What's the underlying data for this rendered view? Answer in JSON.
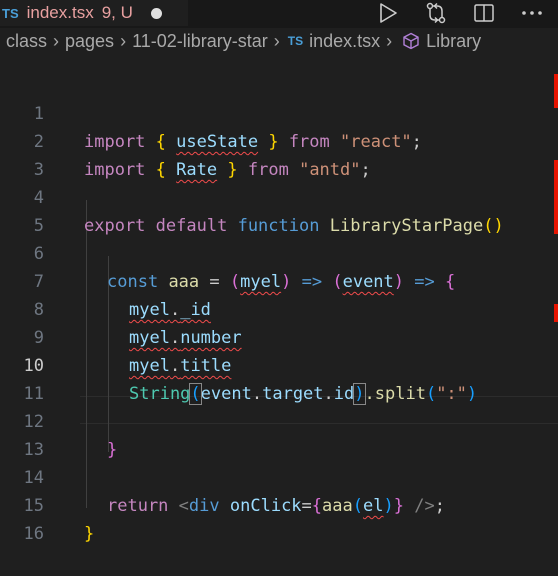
{
  "tab": {
    "lang_badge": "TS",
    "filename": "index.tsx",
    "status": "9, U"
  },
  "actions": [
    "run-icon",
    "source-control-icon",
    "split-editor-icon",
    "more-icon"
  ],
  "breadcrumbs": {
    "items": [
      "class",
      "pages",
      "11-02-library-star"
    ],
    "file_badge": "TS",
    "file": "index.tsx",
    "symbol": "Library"
  },
  "code": {
    "active_line": 10,
    "lines": [
      {
        "n": "1"
      },
      {
        "n": "2"
      },
      {
        "n": "3"
      },
      {
        "n": "4"
      },
      {
        "n": "5"
      },
      {
        "n": "6"
      },
      {
        "n": "7"
      },
      {
        "n": "8"
      },
      {
        "n": "9"
      },
      {
        "n": "10"
      },
      {
        "n": "11"
      },
      {
        "n": "12"
      },
      {
        "n": "13"
      },
      {
        "n": "14"
      },
      {
        "n": "15"
      },
      {
        "n": "16"
      }
    ],
    "tokens": {
      "l1": [
        "import",
        "{",
        "useState",
        "}",
        "from",
        "\"react\"",
        ";"
      ],
      "l2": [
        "import",
        "{",
        "Rate",
        "}",
        "from",
        "\"antd\"",
        ";"
      ],
      "l4": [
        "export",
        "default",
        "function",
        "LibraryStarPage",
        "()"
      ],
      "l6": [
        "const",
        "aaa",
        "=",
        "(",
        "myel",
        ")",
        "=>",
        "(",
        "event",
        ")",
        "=>",
        "{"
      ],
      "l7": [
        "myel",
        ".",
        "_id"
      ],
      "l8": [
        "myel",
        ".",
        "number"
      ],
      "l9": [
        "myel",
        ".",
        "title"
      ],
      "l10": [
        "String",
        "(",
        "event",
        ".",
        "target",
        ".",
        "id",
        ")",
        ".split",
        "(",
        "\":\"",
        ")"
      ],
      "l12": [
        "}"
      ],
      "l14": [
        "return",
        "<",
        "div",
        "onClick",
        "=",
        "{",
        "aaa",
        "(",
        "el",
        ")",
        "}",
        "/>",
        ";"
      ],
      "l15": [
        "}"
      ]
    }
  },
  "colors": {
    "background": "#1f1f1f",
    "error": "#f14c4c",
    "keyword": "#c586c0",
    "string": "#ce9178",
    "function": "#dcdcaa",
    "variable": "#9cdcfe"
  }
}
